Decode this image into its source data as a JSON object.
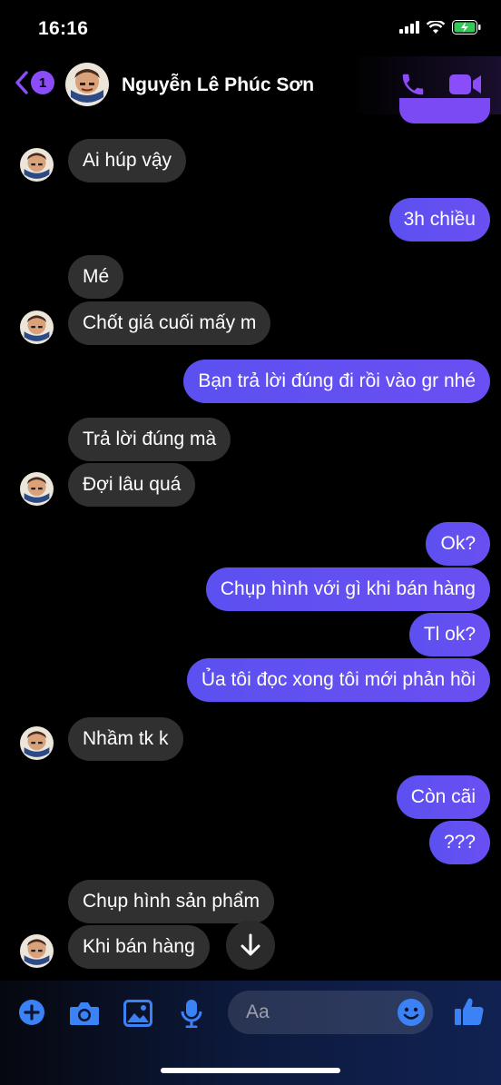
{
  "status_bar": {
    "time": "16:16"
  },
  "header": {
    "unread_count": "1",
    "contact_name": "Nguyễn Lê Phúc Sơn",
    "accent_color": "#8b4dfa"
  },
  "messages": [
    {
      "side": "in",
      "text": "Ai húp vậy"
    },
    {
      "side": "out",
      "text": "3h chiều"
    },
    {
      "side": "in",
      "text": "Mé"
    },
    {
      "side": "in",
      "text": "Chốt giá cuối mấy m"
    },
    {
      "side": "out",
      "text": "Bạn trả lời đúng đi rồi vào gr nhé"
    },
    {
      "side": "in",
      "text": "Trả lời đúng mà"
    },
    {
      "side": "in",
      "text": "Đợi lâu quá"
    },
    {
      "side": "out",
      "text": "Ok?"
    },
    {
      "side": "out",
      "text": "Chụp hình với gì khi bán hàng"
    },
    {
      "side": "out",
      "text": "Tl ok?"
    },
    {
      "side": "out",
      "text": "Ủa tôi đọc xong tôi mới phản hồi"
    },
    {
      "side": "in",
      "text": "Nhầm tk k"
    },
    {
      "side": "out",
      "text": "Còn cãi"
    },
    {
      "side": "out",
      "text": "???"
    },
    {
      "side": "in",
      "text": "Chụp hình sản phẩm"
    },
    {
      "side": "in",
      "text": "Khi bán hàng"
    }
  ],
  "composer": {
    "placeholder": "Aa"
  },
  "colors": {
    "outgoing_bubble": "#6150f1",
    "incoming_bubble": "#303030",
    "icon_accent": "#3b82f6"
  }
}
